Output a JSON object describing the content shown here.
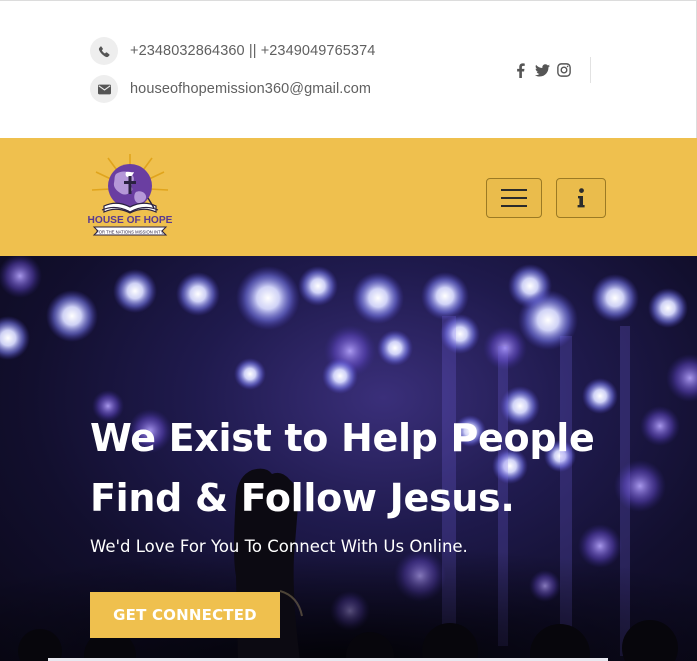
{
  "topbar": {
    "phone": "+2348032864360 || +2349049765374",
    "email": "houseofhopemission360@gmail.com",
    "phone_icon": "phone-icon",
    "email_icon": "envelope-icon",
    "social": [
      "facebook-icon",
      "twitter-icon",
      "instagram-icon"
    ]
  },
  "navbar": {
    "logo_text": "HOUSE OF HOPE",
    "logo_subtext": "FOR THE NATIONS MISSION INT'L",
    "menu_icon": "hamburger-icon",
    "info_icon": "info-icon"
  },
  "hero": {
    "title_line1": "We Exist to Help People",
    "title_line2": "Find & Follow Jesus.",
    "subtitle": "We'd Love For You To Connect With Us Online.",
    "cta_label": "GET CONNECTED"
  },
  "colors": {
    "accent": "#efc04e",
    "text_gray": "#606060",
    "hero_dark": "#120f2e"
  }
}
